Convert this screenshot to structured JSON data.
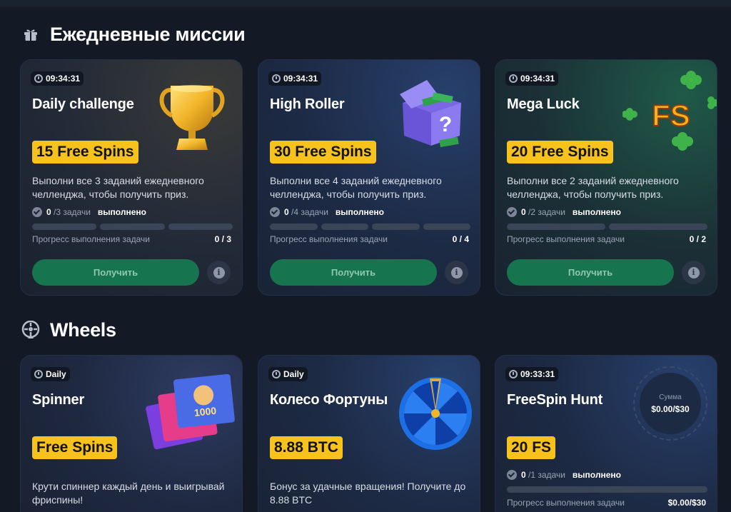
{
  "sections": {
    "missions_title": "Ежедневные миссии",
    "wheels_title": "Wheels"
  },
  "missions": [
    {
      "timer": "09:34:31",
      "title": "Daily challenge",
      "reward": "15 Free Spins",
      "description": "Выполни все 3 заданий ежедневного челленджа, чтобы получить приз.",
      "tasks_done": "0",
      "tasks_total": "/3 задачи",
      "done_label": "выполнено",
      "segments": 3,
      "progress_label": "Прогресс выполнения задачи",
      "progress_value": "0 / 3",
      "claim_label": "Получить",
      "art": "trophy-icon"
    },
    {
      "timer": "09:34:31",
      "title": "High Roller",
      "reward": "30 Free Spins",
      "description": "Выполни все 4 заданий ежедневного челленджа, чтобы получить приз.",
      "tasks_done": "0",
      "tasks_total": "/4 задачи",
      "done_label": "выполнено",
      "segments": 4,
      "progress_label": "Прогресс выполнения задачи",
      "progress_value": "0 / 4",
      "claim_label": "Получить",
      "art": "mystery-box-icon"
    },
    {
      "timer": "09:34:31",
      "title": "Mega Luck",
      "reward": "20 Free Spins",
      "description": "Выполни все 2 заданий ежедневного челленджа, чтобы получить приз.",
      "tasks_done": "0",
      "tasks_total": "/2 задачи",
      "done_label": "выполнено",
      "segments": 2,
      "progress_label": "Прогресс выполнения задачи",
      "progress_value": "0 / 2",
      "claim_label": "Получить",
      "art": "fs-clover-icon",
      "art_text": "FS"
    }
  ],
  "wheels": [
    {
      "timer": "Daily",
      "title": "Spinner",
      "reward": "Free Spins",
      "description": "Крути спиннер каждый день и выигрывай фриспины!",
      "art": "game-cards-icon",
      "art_text": "1000"
    },
    {
      "timer": "Daily",
      "title": "Колесо Фортуны",
      "reward": "8.88 BTC",
      "description": "Бонус за удачные вращения! Получите до 8.88 BTC",
      "art": "fortune-wheel-icon"
    },
    {
      "timer": "09:33:31",
      "title": "FreeSpin Hunt",
      "reward": "20 FS",
      "tasks_done": "0",
      "tasks_total": "/1 задачи",
      "done_label": "выполнено",
      "progress_label": "Прогресс выполнения задачи",
      "progress_value": "$0.00/$30",
      "sum_label": "Сумма",
      "sum_value": "$0.00/$30"
    }
  ],
  "colors": {
    "background": "#131a26",
    "reward_badge": "#f7c21b",
    "claim_button": "#16744f"
  }
}
